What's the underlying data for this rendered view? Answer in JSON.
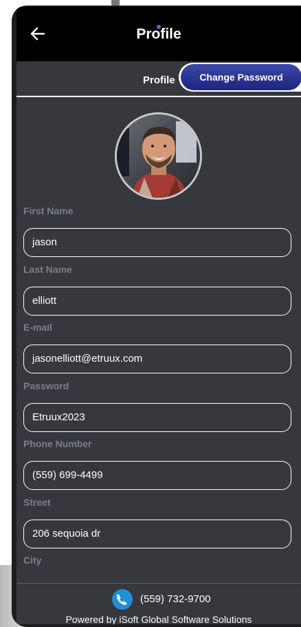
{
  "header": {
    "title": "Profile",
    "back_icon": "arrow-left-icon"
  },
  "tabs": [
    {
      "label": "Profile",
      "active": true
    },
    {
      "label": "Change Password",
      "active": false
    }
  ],
  "avatar": {
    "kind": "profile-photo"
  },
  "form": {
    "fields": [
      {
        "label": "First Name",
        "value": "jason"
      },
      {
        "label": "Last Name",
        "value": "elliott"
      },
      {
        "label": "E-mail",
        "value": "jasonelliott@etruux.com"
      },
      {
        "label": "Password",
        "value": "Etruux2023"
      },
      {
        "label": "Phone Number",
        "value": "(559) 699-4499"
      },
      {
        "label": "Street",
        "value": "206 sequoia dr"
      },
      {
        "label": "City",
        "value": ""
      }
    ]
  },
  "footer": {
    "phone": "(559) 732-9700",
    "phone_icon": "phone-icon",
    "powered_by": "Powered by iSoft Global Software Solutions"
  },
  "colors": {
    "app_bar": "#000000",
    "background": "#36383e",
    "accent": "#2a3294",
    "label": "#7c7f87",
    "phone_icon": "#1f8fd6"
  }
}
